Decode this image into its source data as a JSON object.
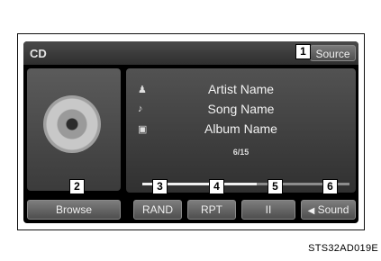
{
  "screen": {
    "title": "CD",
    "source_label": "Source"
  },
  "track_info": {
    "artist": "Artist Name",
    "song": "Song Name",
    "album": "Album Name",
    "track_counter": "6/15",
    "progress_fraction": 0.55,
    "icons": [
      "person-icon",
      "music-note-icon",
      "album-icon"
    ]
  },
  "buttons": {
    "browse": "Browse",
    "rand": "RAND",
    "rpt": "RPT",
    "pause": "II",
    "sound": "Sound"
  },
  "callouts": [
    "1",
    "2",
    "3",
    "4",
    "5",
    "6"
  ],
  "caption": "STS32AD019E"
}
